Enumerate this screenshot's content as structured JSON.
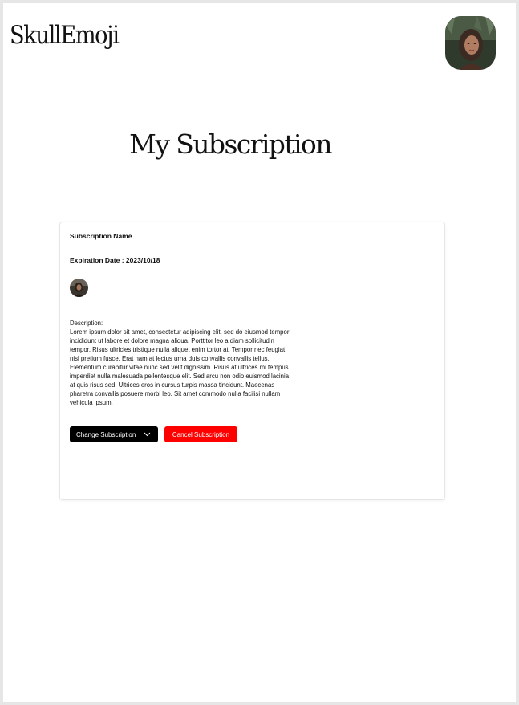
{
  "header": {
    "logo_text": "SkullEmoji",
    "profile_avatar_icon": "user-photo-avatar"
  },
  "main": {
    "title": "My Subscription"
  },
  "subscription": {
    "name": "Subscription Name",
    "expiration": "Expiration Date : 2023/10/18",
    "thumbnail_icon": "user-photo-avatar",
    "description_label": "Description:",
    "description_text": "Lorem ipsum dolor sit amet, consectetur adipiscing elit, sed do eiusmod tempor incididunt ut labore et dolore magna aliqua. Porttitor leo a diam sollicitudin tempor. Risus ultricies tristique nulla aliquet enim  tortor at. Tempor nec feugiat nisl pretium fusce. Erat nam at lectus  urna duis convallis convallis tellus. Elementum curabitur vitae nunc sed  velit dignissim. Risus at ultrices mi tempus imperdiet nulla malesuada pellentesque elit. Sed arcu non odio euismod lacinia at quis risus sed. Ultrices eros in cursus turpis massa tincidunt. Maecenas pharetra convallis posuere morbi leo. Sit amet commodo nulla facilisi nullam vehicula ipsum.",
    "change_label": "Change Subscription",
    "cancel_label": "Cancel Subscription"
  },
  "colors": {
    "cancel_button": "#ff0000",
    "change_button": "#000000",
    "background": "#ffffff",
    "frame": "#e6e6e6"
  }
}
